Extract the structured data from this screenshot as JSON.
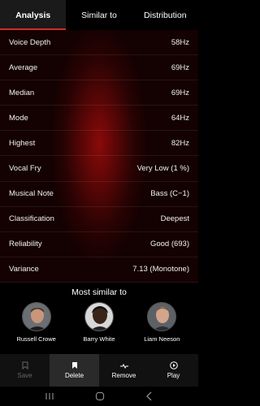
{
  "tabs": [
    {
      "label": "Analysis",
      "active": true
    },
    {
      "label": "Similar to",
      "active": false
    },
    {
      "label": "Distribution",
      "active": false
    }
  ],
  "metrics": [
    {
      "label": "Voice Depth",
      "value": "58Hz"
    },
    {
      "label": "Average",
      "value": "69Hz"
    },
    {
      "label": "Median",
      "value": "69Hz"
    },
    {
      "label": "Mode",
      "value": "64Hz"
    },
    {
      "label": "Highest",
      "value": "82Hz"
    },
    {
      "label": "Vocal Fry",
      "value": "Very Low (1 %)"
    },
    {
      "label": "Musical Note",
      "value": "Bass (C−1)"
    },
    {
      "label": "Classification",
      "value": "Deepest"
    },
    {
      "label": "Reliability",
      "value": "Good (693)"
    },
    {
      "label": "Variance",
      "value": "7.13 (Monotone)"
    }
  ],
  "similar": {
    "title": "Most similar to",
    "people": [
      {
        "name": "Russell Crowe"
      },
      {
        "name": "Barry White"
      },
      {
        "name": "Liam Neeson"
      }
    ]
  },
  "bottom_bar": {
    "save": "Save",
    "delete": "Delete",
    "remove": "Remove",
    "play": "Play"
  },
  "colors": {
    "accent": "#d42a2a",
    "panel_glow": "#8a0a0a"
  }
}
